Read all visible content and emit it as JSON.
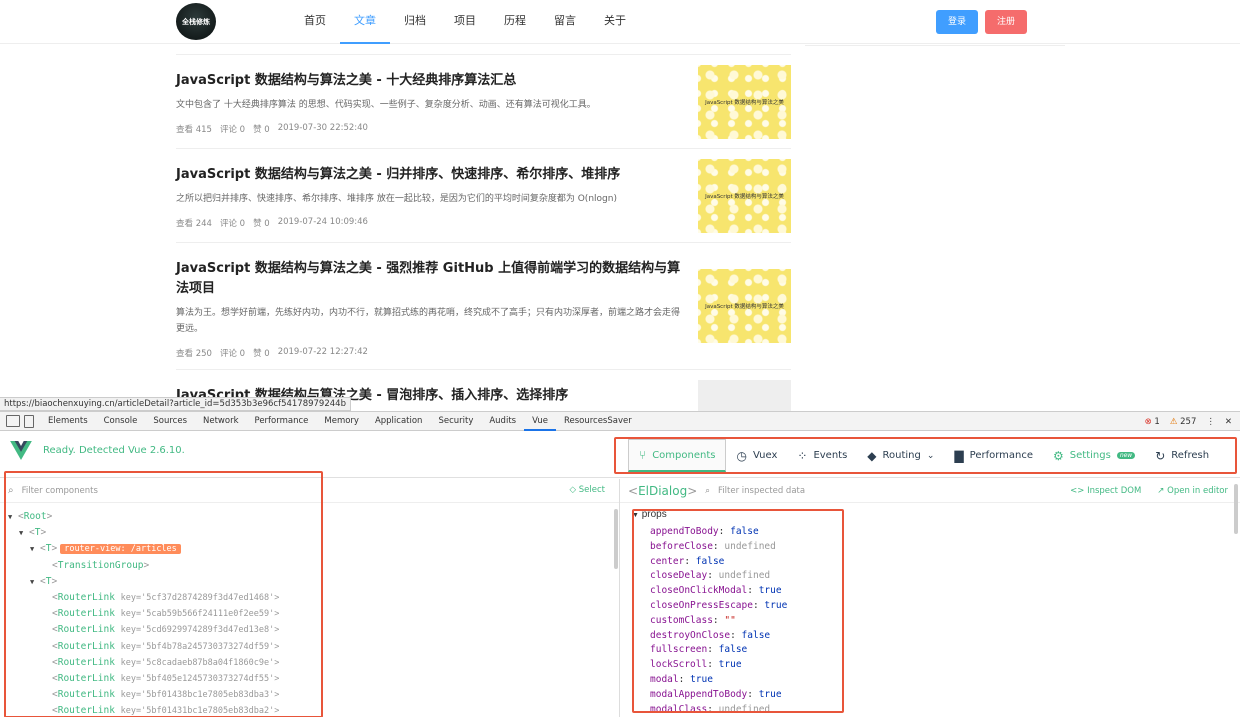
{
  "site": {
    "logo_text": "全栈修炼",
    "nav": [
      "首页",
      "文章",
      "归档",
      "项目",
      "历程",
      "留言",
      "关于"
    ],
    "active_nav": "文章",
    "login": "登录",
    "register": "注册"
  },
  "articles": [
    {
      "title": "JavaScript 数据结构与算法之美 - 十大经典排序算法汇总",
      "desc": "文中包含了 十大经典排序算法 的思想、代码实现、一些例子、复杂度分析、动画、还有算法可视化工具。",
      "views": "查看 415",
      "comments": "评论 0",
      "likes": "赞 0",
      "date": "2019-07-30 22:52:40",
      "thumb": "JavaScript 数据结构与算法之美"
    },
    {
      "title": "JavaScript 数据结构与算法之美 - 归并排序、快速排序、希尔排序、堆排序",
      "desc": "之所以把归并排序、快速排序、希尔排序、堆排序 放在一起比较，是因为它们的平均时间复杂度都为 O(nlogn)",
      "views": "查看 244",
      "comments": "评论 0",
      "likes": "赞 0",
      "date": "2019-07-24 10:09:46",
      "thumb": "JavaScript 数据结构与算法之美"
    },
    {
      "title": "JavaScript 数据结构与算法之美 - 强烈推荐 GitHub 上值得前端学习的数据结构与算法项目",
      "desc": "算法为王。想学好前端，先练好内功，内功不行，就算招式练的再花哨，终究成不了高手；只有内功深厚者，前端之路才会走得更远。",
      "views": "查看 250",
      "comments": "评论 0",
      "likes": "赞 0",
      "date": "2019-07-22 12:27:42",
      "thumb": "JavaScript 数据结构与算法之美"
    },
    {
      "title": "JavaScript 数据结构与算法之美 - 冒泡排序、插入排序、选择排序"
    }
  ],
  "status_url": "https://biaochenxuying.cn/articleDetail?article_id=5d353b3e96cf54178979244b",
  "devtools": {
    "tabs": [
      "Elements",
      "Console",
      "Sources",
      "Network",
      "Performance",
      "Memory",
      "Application",
      "Security",
      "Audits",
      "Vue",
      "ResourcesSaver"
    ],
    "active_tab": "Vue",
    "errors": "1",
    "warnings": "257",
    "vue": {
      "ready_text": "Ready. Detected Vue 2.6.10.",
      "tabs": [
        {
          "label": "Components",
          "icon": "components-icon"
        },
        {
          "label": "Vuex",
          "icon": "history-icon"
        },
        {
          "label": "Events",
          "icon": "events-icon"
        },
        {
          "label": "Routing",
          "icon": "routing-icon"
        },
        {
          "label": "Performance",
          "icon": "chart-icon"
        },
        {
          "label": "Settings",
          "icon": "settings-icon",
          "badge": "new"
        },
        {
          "label": "Refresh",
          "icon": "refresh-icon"
        }
      ],
      "filter_components_placeholder": "Filter components",
      "select_label": "Select",
      "tree": {
        "root": "Root",
        "t1": "T",
        "t2": "T",
        "router_view": "router-view: /articles",
        "transition_group": "TransitionGroup",
        "t3": "T",
        "router_links": [
          {
            "name": "RouterLink",
            "key": "key='5cf37d2874289f3d47ed1468'>"
          },
          {
            "name": "RouterLink",
            "key": "key='5cab59b566f24111e0f2ee59'>"
          },
          {
            "name": "RouterLink",
            "key": "key='5cd6929974289f3d47ed13e8'>"
          },
          {
            "name": "RouterLink",
            "key": "key='5bf4b78a245730373274df59'>"
          },
          {
            "name": "RouterLink",
            "key": "key='5c8cadaeb87b8a04f1860c9e'>"
          },
          {
            "name": "RouterLink",
            "key": "key='5bf405e1245730373274df55'>"
          },
          {
            "name": "RouterLink",
            "key": "key='5bf01438bc1e7805eb83dba3'>"
          },
          {
            "name": "RouterLink",
            "key": "key='5bf01431bc1e7805eb83dba2'>"
          }
        ]
      },
      "inspected": {
        "name": "ElDialog",
        "filter_placeholder": "Filter inspected data",
        "inspect_dom": "Inspect DOM",
        "open_in_editor": "Open in editor",
        "section": "props",
        "props": [
          {
            "key": "appendToBody",
            "value": "false",
            "type": "bool"
          },
          {
            "key": "beforeClose",
            "value": "undefined",
            "type": "undef"
          },
          {
            "key": "center",
            "value": "false",
            "type": "bool"
          },
          {
            "key": "closeDelay",
            "value": "undefined",
            "type": "undef"
          },
          {
            "key": "closeOnClickModal",
            "value": "true",
            "type": "bool"
          },
          {
            "key": "closeOnPressEscape",
            "value": "true",
            "type": "bool"
          },
          {
            "key": "customClass",
            "value": "\"\"",
            "type": "str"
          },
          {
            "key": "destroyOnClose",
            "value": "false",
            "type": "bool"
          },
          {
            "key": "fullscreen",
            "value": "false",
            "type": "bool"
          },
          {
            "key": "lockScroll",
            "value": "true",
            "type": "bool"
          },
          {
            "key": "modal",
            "value": "true",
            "type": "bool"
          },
          {
            "key": "modalAppendToBody",
            "value": "true",
            "type": "bool"
          },
          {
            "key": "modalClass",
            "value": "undefined",
            "type": "undef"
          }
        ]
      }
    }
  },
  "colors": {
    "vue_green": "#42b983",
    "highlight": "#e8553a",
    "primary": "#409eff",
    "danger": "#f56c6c"
  }
}
